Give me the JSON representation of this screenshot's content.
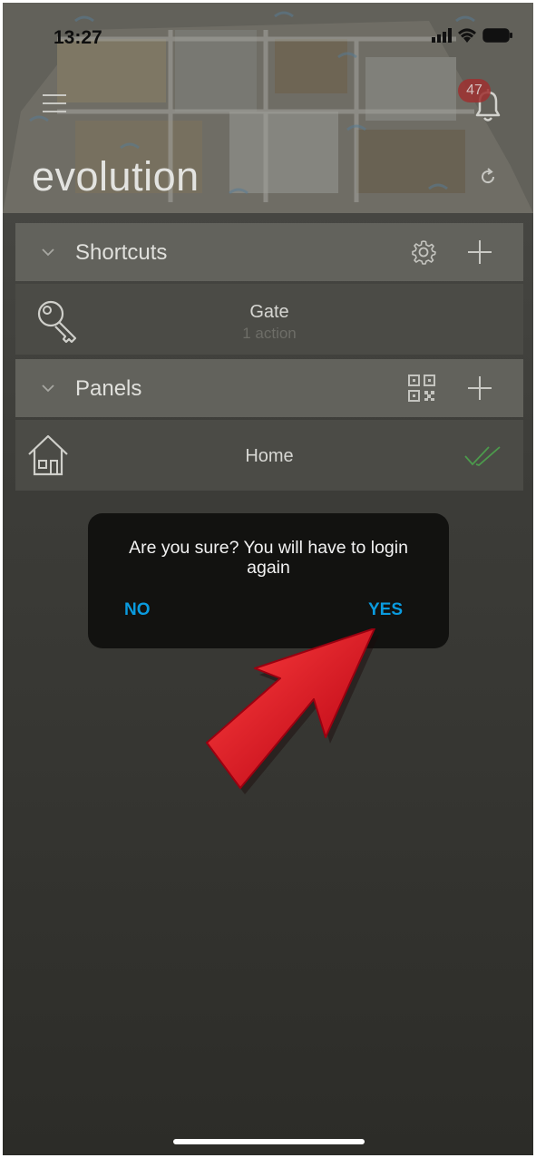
{
  "status_bar": {
    "time": "13:27"
  },
  "header": {
    "app_title": "evolution",
    "notification_count": "47"
  },
  "sections": {
    "shortcuts": {
      "label": "Shortcuts"
    },
    "panels": {
      "label": "Panels"
    }
  },
  "shortcut_items": [
    {
      "title": "Gate",
      "subtitle": "1 action",
      "icon": "key-icon"
    }
  ],
  "panel_items": [
    {
      "title": "Home",
      "icon": "house-icon",
      "status_icon": "double-check-icon"
    }
  ],
  "dialog": {
    "message": "Are you sure? You will have to login again",
    "no_label": "NO",
    "yes_label": "YES"
  },
  "colors": {
    "accent": "#0a9bdf",
    "arrow": "#e0101a",
    "check": "#4c9a4c",
    "badge": "#9e3030"
  }
}
